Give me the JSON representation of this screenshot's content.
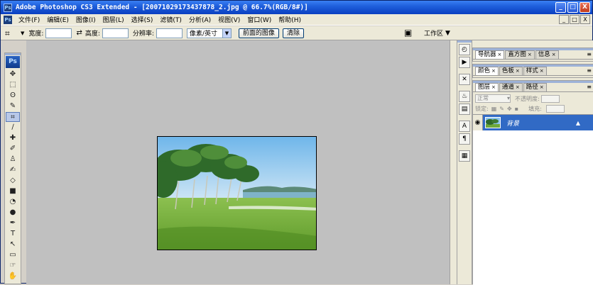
{
  "window": {
    "title": "Adobe Photoshop CS3 Extended - [20071029173437878_2.jpg @ 66.7%(RGB/8#)]",
    "app_icon": "Ps",
    "controls": [
      "_",
      "□",
      "X"
    ]
  },
  "menubar": {
    "logo": "Ps",
    "items": [
      "文件(F)",
      "编辑(E)",
      "图像(I)",
      "图层(L)",
      "选择(S)",
      "滤镜(T)",
      "分析(A)",
      "视图(V)",
      "窗口(W)",
      "帮助(H)"
    ],
    "doc_controls": [
      "_",
      "□",
      "X"
    ]
  },
  "options": {
    "tool_icon": "crop-icon",
    "width_label": "宽度:",
    "width_value": "",
    "swap_symbol": "⇄",
    "height_label": "高度:",
    "height_value": "",
    "resolution_label": "分辨率:",
    "resolution_value": "",
    "unit_select": "像素/英寸",
    "front_image_button": "前面的图像",
    "clear_button": "清除",
    "workspace_label": "工作区",
    "workspace_arrow": "▼"
  },
  "toolbox": {
    "logo": "Ps",
    "tools": [
      "✥",
      "⬚",
      "ʘ",
      "✎",
      "⌗",
      "∕",
      "✚",
      "✐",
      "♙",
      "✍",
      "◇",
      "■",
      "◔",
      "●",
      "✒",
      "T",
      "↖",
      "▭",
      "☞",
      "✋"
    ]
  },
  "dock": {
    "icons": [
      "◴",
      "▶",
      "✕",
      "♨",
      "▤",
      "A",
      "¶",
      "▦"
    ]
  },
  "panels": {
    "group1_tabs": [
      "导航器",
      "直方图",
      "信息"
    ],
    "group2_tabs": [
      "颜色",
      "色板",
      "样式"
    ],
    "group3_tabs": [
      "图层",
      "通道",
      "路径"
    ],
    "blend_mode": "正常",
    "opacity_label": "不透明度:",
    "lock_label": "锁定:",
    "fill_label": "填充:",
    "layer_name": "背景"
  },
  "colors": {
    "titlebar": "#0a3fc0",
    "canvas_bg": "#c0c0c0",
    "selected_layer": "#316ac5"
  }
}
